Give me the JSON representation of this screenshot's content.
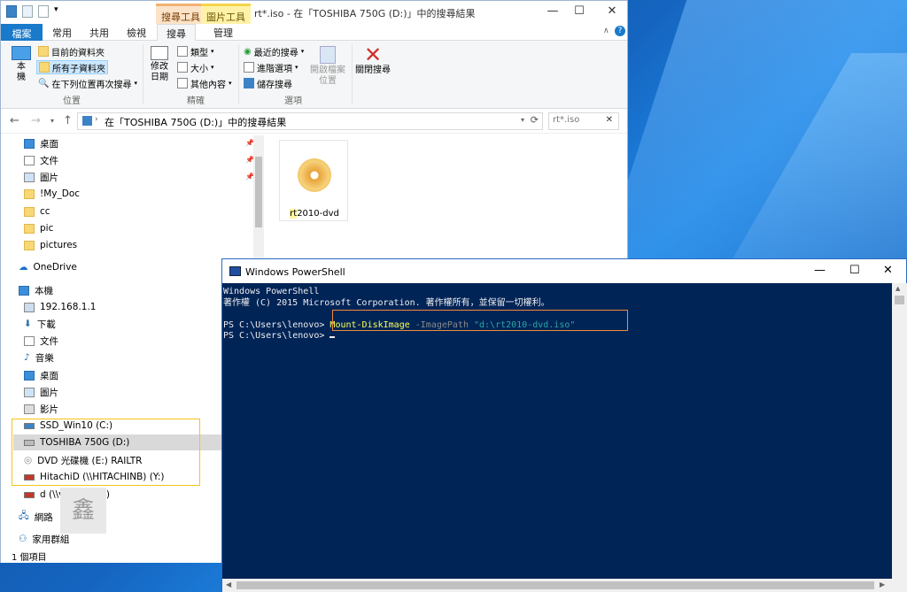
{
  "explorer": {
    "title": "rt*.iso - 在「TOSHIBA 750G (D:)」中的搜尋結果",
    "context_tabs": [
      "搜尋工具",
      "圖片工具"
    ],
    "tabs": [
      "檔案",
      "常用",
      "共用",
      "檢視",
      "搜尋",
      "管理"
    ],
    "ribbon": {
      "location": {
        "this_pc": "本\n機",
        "current_folder": "目前的資料夾",
        "all_subfolders": "所有子資料夾",
        "search_again": "在下列位置再次搜尋",
        "label": "位置"
      },
      "refine": {
        "date_modified": "修改\n日期",
        "kind": "類型",
        "size": "大小",
        "other_props": "其他內容",
        "label": "精確"
      },
      "options": {
        "recent": "最近的搜尋",
        "advanced": "進階選項",
        "save_search": "儲存搜尋",
        "open_location": "開啟檔案\n位置",
        "label": "選項"
      },
      "close_search": "關閉搜尋"
    },
    "address": "在「TOSHIBA 750G (D:)」中的搜尋結果",
    "search_value": "rt*.iso",
    "nav": {
      "quick": [
        "桌面",
        "文件",
        "圖片",
        "!My_Doc",
        "cc",
        "pic",
        "pictures"
      ],
      "onedrive": "OneDrive",
      "thispc": "本機",
      "thispc_items": [
        "192.168.1.1",
        "下載",
        "文件",
        "音樂",
        "桌面",
        "圖片",
        "影片"
      ],
      "drives": [
        "SSD_Win10 (C:)",
        "TOSHIBA 750G (D:)",
        "DVD 光碟機 (E:) RAILTR",
        "HitachiD (\\\\HITACHINB) (Y:)",
        "d (\\\\venus) (Z:)"
      ],
      "network": "網路",
      "homegroup": "家用群組"
    },
    "file": {
      "name_prefix": "rt",
      "name_rest": "2010-dvd"
    },
    "status": "1 個項目",
    "watermark": "鑫"
  },
  "powershell": {
    "title": "Windows PowerShell",
    "line1": "Windows PowerShell",
    "line2": "著作權 (C) 2015 Microsoft Corporation. 著作權所有，並保留一切權利。",
    "prompt": "PS C:\\Users\\lenovo> ",
    "cmd": "Mount-DiskImage",
    "param": " -ImagePath ",
    "arg": "\"d:\\rt2010-dvd.iso\"",
    "prompt2": "PS C:\\Users\\lenovo> "
  }
}
